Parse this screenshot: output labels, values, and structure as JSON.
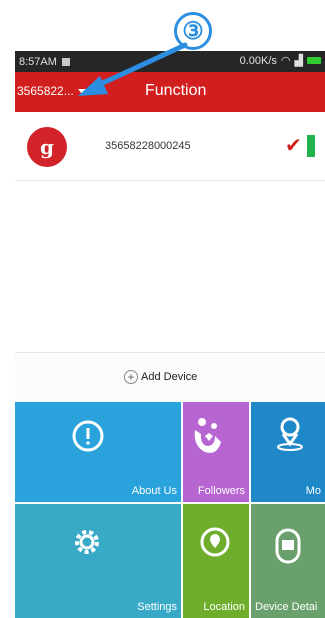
{
  "annotation": {
    "number": "③",
    "color": "#2b8ee0"
  },
  "status_bar": {
    "time": "8:57AM",
    "net_speed": "0.00K/s"
  },
  "title_bar": {
    "device_selector": "3565822...",
    "title": "Function",
    "color": "#d11f1f"
  },
  "device_list": [
    {
      "imei": "35658228000245",
      "logo_icon": "brand-logo-icon",
      "status_icon": "check-icon",
      "battery_icon": "battery-icon"
    }
  ],
  "add_device": {
    "label": "Add Device"
  },
  "tiles": [
    {
      "label": "About Us",
      "icon": "info-icon",
      "color": "#2aa3dc"
    },
    {
      "label": "Followers",
      "icon": "family-icon",
      "color": "#b765d0"
    },
    {
      "label": "Mo",
      "icon": "location-pin-icon",
      "color": "#1e88c8"
    },
    {
      "label": "Settings",
      "icon": "gear-icon",
      "color": "#38a9c7"
    },
    {
      "label": "Location",
      "icon": "location-icon",
      "color": "#6fae2c"
    },
    {
      "label": "Device Detai",
      "icon": "watch-icon",
      "color": "#6aa06c"
    }
  ]
}
